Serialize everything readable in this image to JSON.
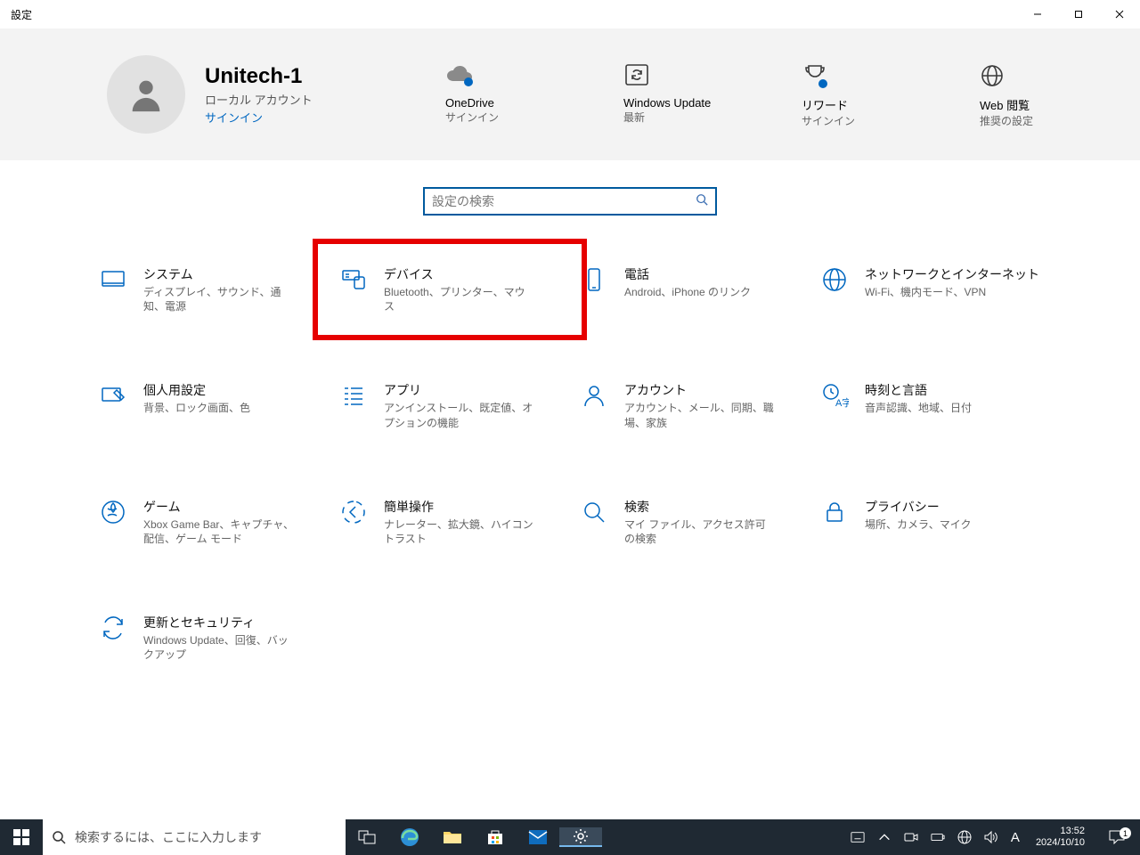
{
  "window_title": "設定",
  "user": {
    "name": "Unitech-1",
    "account_type": "ローカル アカウント",
    "signin": "サインイン"
  },
  "status_tiles": {
    "onedrive": {
      "name": "OneDrive",
      "sub": "サインイン"
    },
    "update": {
      "name": "Windows Update",
      "sub": "最新"
    },
    "rewards": {
      "name": "リワード",
      "sub": "サインイン"
    },
    "web": {
      "name": "Web 閲覧",
      "sub": "推奨の設定"
    }
  },
  "search_placeholder": "設定の検索",
  "categories": {
    "system": {
      "title": "システム",
      "desc": "ディスプレイ、サウンド、通知、電源"
    },
    "devices": {
      "title": "デバイス",
      "desc": "Bluetooth、プリンター、マウス"
    },
    "phone": {
      "title": "電話",
      "desc": "Android、iPhone のリンク"
    },
    "network": {
      "title": "ネットワークとインターネット",
      "desc": "Wi-Fi、機内モード、VPN"
    },
    "personalize": {
      "title": "個人用設定",
      "desc": "背景、ロック画面、色"
    },
    "apps": {
      "title": "アプリ",
      "desc": "アンインストール、既定値、オプションの機能"
    },
    "accounts": {
      "title": "アカウント",
      "desc": "アカウント、メール、同期、職場、家族"
    },
    "time": {
      "title": "時刻と言語",
      "desc": "音声認識、地域、日付"
    },
    "gaming": {
      "title": "ゲーム",
      "desc": "Xbox Game Bar、キャプチャ、配信、ゲーム モード"
    },
    "ease": {
      "title": "簡単操作",
      "desc": "ナレーター、拡大鏡、ハイコントラスト"
    },
    "search": {
      "title": "検索",
      "desc": "マイ ファイル、アクセス許可の検索"
    },
    "privacy": {
      "title": "プライバシー",
      "desc": "場所、カメラ、マイク"
    },
    "updatesec": {
      "title": "更新とセキュリティ",
      "desc": "Windows Update、回復、バックアップ"
    }
  },
  "taskbar": {
    "search_placeholder": "検索するには、ここに入力します",
    "ime": "A",
    "time": "13:52",
    "date": "2024/10/10",
    "notif_count": "1"
  }
}
